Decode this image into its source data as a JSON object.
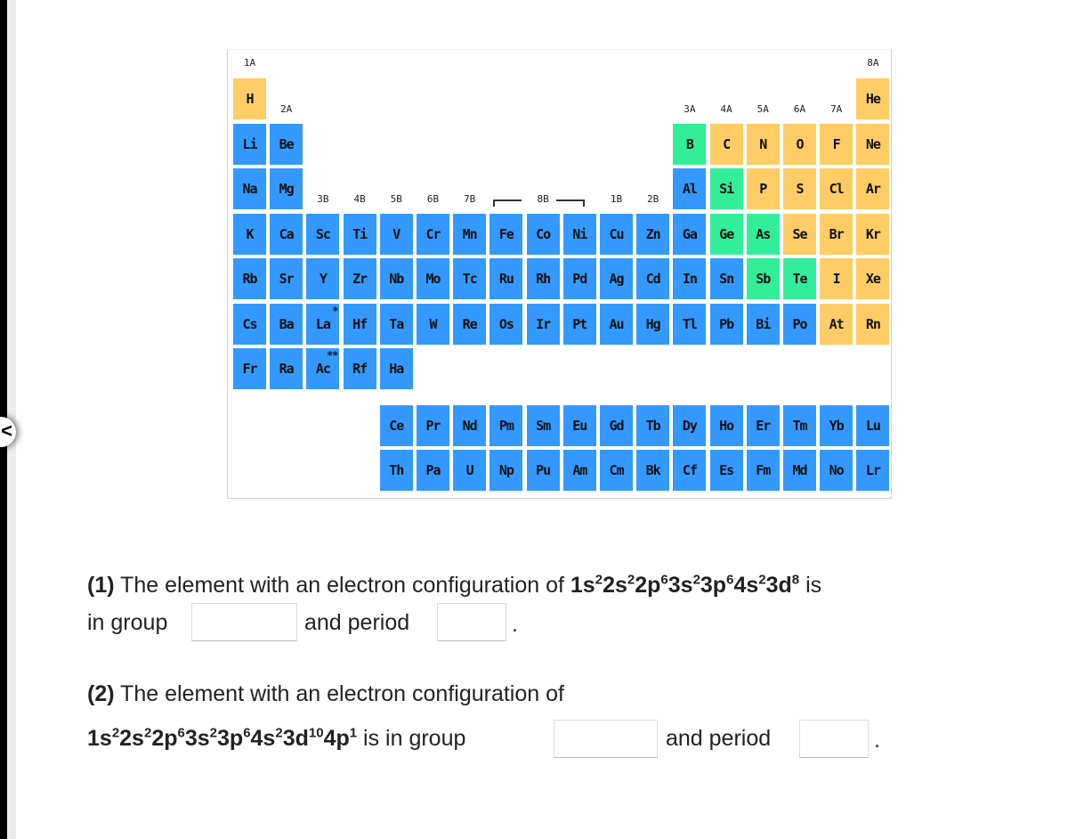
{
  "colors": {
    "blue": "#3399ff",
    "orange": "#ffcc66",
    "green": "#33ee99"
  },
  "periodic_table": {
    "group_labels": [
      {
        "text": "1A",
        "col": 0,
        "row": -1
      },
      {
        "text": "2A",
        "col": 1,
        "row": 0
      },
      {
        "text": "3A",
        "col": 12,
        "row": 0
      },
      {
        "text": "4A",
        "col": 13,
        "row": 0
      },
      {
        "text": "5A",
        "col": 14,
        "row": 0
      },
      {
        "text": "6A",
        "col": 15,
        "row": 0
      },
      {
        "text": "7A",
        "col": 16,
        "row": 0
      },
      {
        "text": "8A",
        "col": 17,
        "row": -1
      },
      {
        "text": "3B",
        "col": 2,
        "row": 2
      },
      {
        "text": "4B",
        "col": 3,
        "row": 2
      },
      {
        "text": "5B",
        "col": 4,
        "row": 2
      },
      {
        "text": "6B",
        "col": 5,
        "row": 2
      },
      {
        "text": "7B",
        "col": 6,
        "row": 2
      },
      {
        "text": "8B",
        "col": 8,
        "row": 2
      },
      {
        "text": "1B",
        "col": 10,
        "row": 2
      },
      {
        "text": "2B",
        "col": 11,
        "row": 2
      }
    ],
    "orange": [
      "H",
      "He",
      "C",
      "N",
      "O",
      "F",
      "Ne",
      "P",
      "S",
      "Cl",
      "Ar",
      "Se",
      "Br",
      "Kr",
      "I",
      "Xe",
      "At",
      "Rn"
    ],
    "green": [
      "B",
      "Si",
      "Ge",
      "As",
      "Sb",
      "Te"
    ],
    "rows": [
      [
        "H",
        "",
        "",
        "",
        "",
        "",
        "",
        "",
        "",
        "",
        "",
        "",
        "",
        "",
        "",
        "",
        "",
        "He"
      ],
      [
        "Li",
        "Be",
        "",
        "",
        "",
        "",
        "",
        "",
        "",
        "",
        "",
        "",
        "B",
        "C",
        "N",
        "O",
        "F",
        "Ne"
      ],
      [
        "Na",
        "Mg",
        "",
        "",
        "",
        "",
        "",
        "",
        "",
        "",
        "",
        "",
        "Al",
        "Si",
        "P",
        "S",
        "Cl",
        "Ar"
      ],
      [
        "K",
        "Ca",
        "Sc",
        "Ti",
        "V",
        "Cr",
        "Mn",
        "Fe",
        "Co",
        "Ni",
        "Cu",
        "Zn",
        "Ga",
        "Ge",
        "As",
        "Se",
        "Br",
        "Kr"
      ],
      [
        "Rb",
        "Sr",
        "Y",
        "Zr",
        "Nb",
        "Mo",
        "Tc",
        "Ru",
        "Rh",
        "Pd",
        "Ag",
        "Cd",
        "In",
        "Sn",
        "Sb",
        "Te",
        "I",
        "Xe"
      ],
      [
        "Cs",
        "Ba",
        "La",
        "Hf",
        "Ta",
        "W",
        "Re",
        "Os",
        "Ir",
        "Pt",
        "Au",
        "Hg",
        "Tl",
        "Pb",
        "Bi",
        "Po",
        "At",
        "Rn"
      ],
      [
        "Fr",
        "Ra",
        "Ac",
        "Rf",
        "Ha"
      ]
    ],
    "markers": {
      "La": "*",
      "Ac": "**"
    },
    "lanthanides": [
      "Ce",
      "Pr",
      "Nd",
      "Pm",
      "Sm",
      "Eu",
      "Gd",
      "Tb",
      "Dy",
      "Ho",
      "Er",
      "Tm",
      "Yb",
      "Lu"
    ],
    "actinides": [
      "Th",
      "Pa",
      "U",
      "Np",
      "Pu",
      "Am",
      "Cm",
      "Bk",
      "Cf",
      "Es",
      "Fm",
      "Md",
      "No",
      "Lr"
    ]
  },
  "q1": {
    "number": "(1)",
    "text_a": " The element with an electron configuration of ",
    "config": [
      [
        "1s",
        "2"
      ],
      [
        "2s",
        "2"
      ],
      [
        "2p",
        "6"
      ],
      [
        "3s",
        "2"
      ],
      [
        "3p",
        "6"
      ],
      [
        "4s",
        "2"
      ],
      [
        "3d",
        "8"
      ]
    ],
    "text_b": " is",
    "text_c": "in group",
    "text_d": "and period",
    "end": ".",
    "group_value": "",
    "period_value": ""
  },
  "q2": {
    "number": "(2)",
    "text_a": " The element with an electron configuration of",
    "config": [
      [
        "1s",
        "2"
      ],
      [
        "2s",
        "2"
      ],
      [
        "2p",
        "6"
      ],
      [
        "3s",
        "2"
      ],
      [
        "3p",
        "6"
      ],
      [
        "4s",
        "2"
      ],
      [
        "3d",
        "10"
      ],
      [
        "4p",
        "1"
      ]
    ],
    "text_b": " is in group",
    "text_d": "and period",
    "end": ".",
    "group_value": "",
    "period_value": ""
  }
}
